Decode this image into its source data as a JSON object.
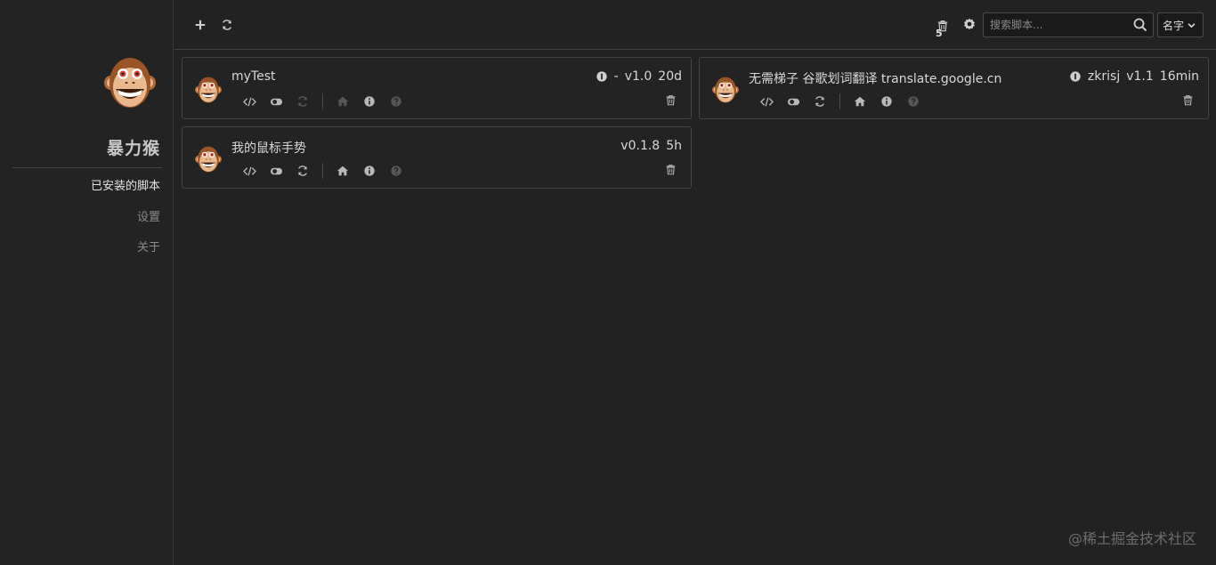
{
  "sidebar": {
    "brand": "暴力猴",
    "items": [
      {
        "label": "已安装的脚本",
        "active": true
      },
      {
        "label": "设置",
        "active": false
      },
      {
        "label": "关于",
        "active": false
      }
    ]
  },
  "toolbar": {
    "add_icon": "plus-icon",
    "update_all_icon": "refresh-icon",
    "trash_icon": "trash-icon",
    "trash_count": "5",
    "settings_icon": "gear-icon",
    "search": {
      "placeholder": "搜索脚本...",
      "value": ""
    },
    "sort": {
      "selected": "名字"
    }
  },
  "scripts": [
    {
      "name": "myTest",
      "author": "-",
      "version": "v1.0",
      "age": "20d",
      "has_author_icon": true,
      "homepage_enabled": false,
      "update_enabled": false
    },
    {
      "name": "无需梯子 谷歌划词翻译 translate.google.cn",
      "author": "zkrisj",
      "version": "v1.1",
      "age": "16min",
      "has_author_icon": true,
      "homepage_enabled": true,
      "update_enabled": true
    },
    {
      "name": "我的鼠标手势",
      "author": "",
      "version": "v0.1.8",
      "age": "5h",
      "has_author_icon": false,
      "homepage_enabled": true,
      "update_enabled": true
    }
  ],
  "watermark": "@稀土掘金技术社区",
  "colors": {
    "background": "#222222",
    "border": "#444444",
    "text": "#d8d8d8",
    "muted": "#8a8a8a",
    "monkey": "#b46a34"
  }
}
